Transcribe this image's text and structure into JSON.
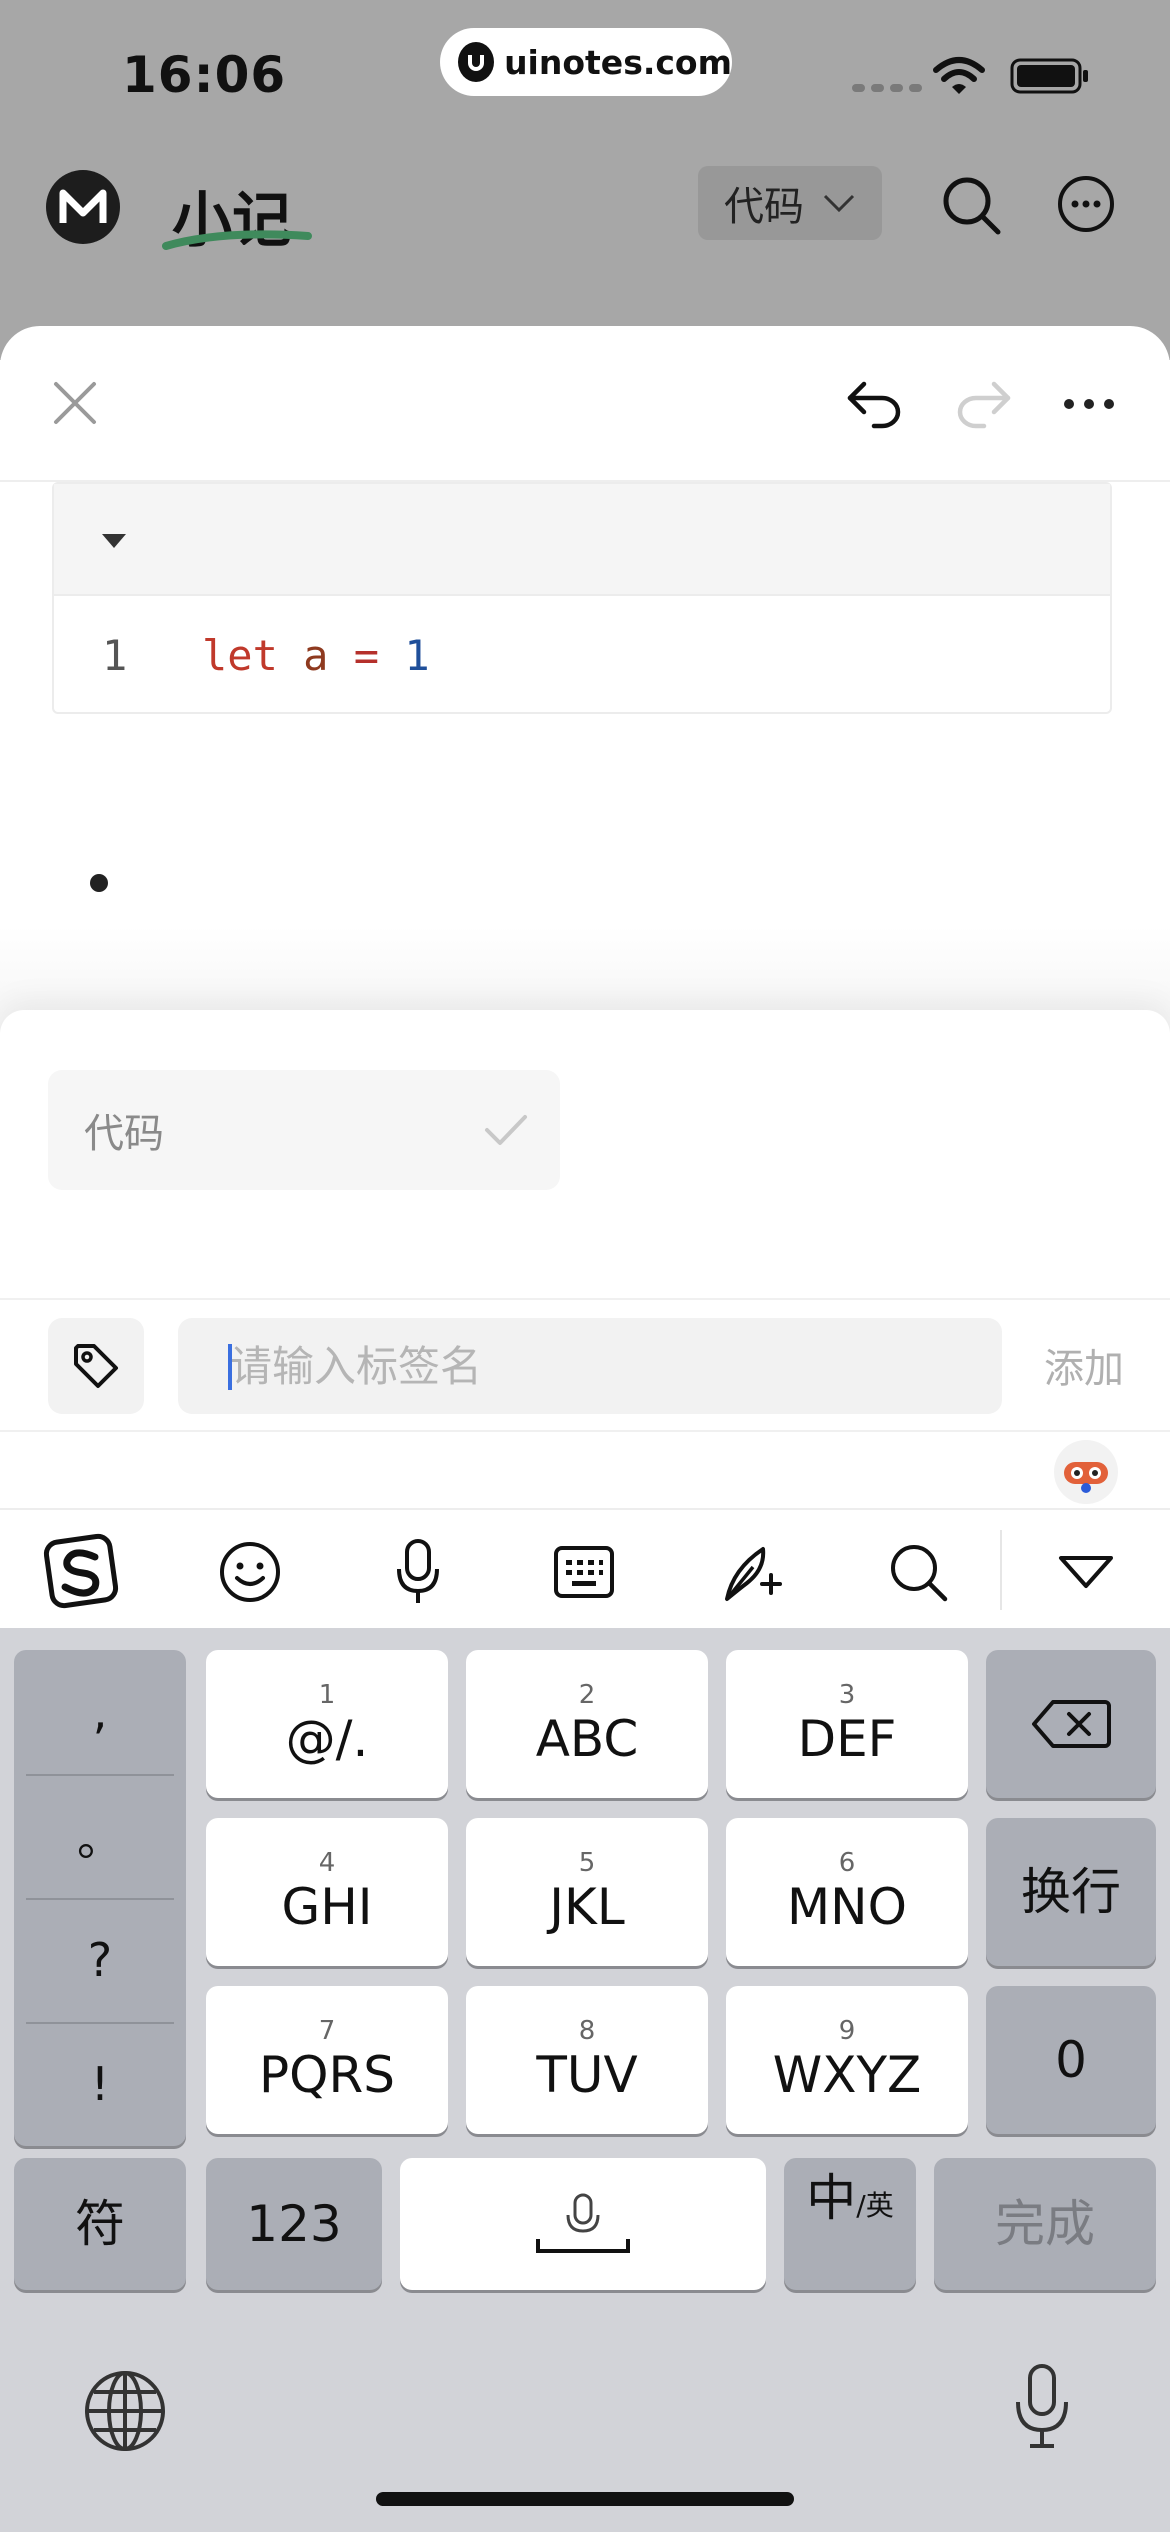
{
  "status_bar": {
    "time": "16:06",
    "url": "uinotes.com"
  },
  "app_header": {
    "title": "小记",
    "filter_label": "代码"
  },
  "editor": {
    "code_block": {
      "line_number": "1",
      "tokens": {
        "keyword": "let",
        "variable": "a",
        "operator": "=",
        "number": "1"
      }
    }
  },
  "tag_panel": {
    "selected_tag": "代码",
    "input_placeholder": "请输入标签名",
    "input_value": "",
    "add_label": "添加"
  },
  "keyboard": {
    "punctuation": [
      ",",
      "。",
      "?",
      "!"
    ],
    "keys": [
      {
        "num": "1",
        "label": "@/."
      },
      {
        "num": "2",
        "label": "ABC"
      },
      {
        "num": "3",
        "label": "DEF"
      },
      {
        "num": "4",
        "label": "GHI"
      },
      {
        "num": "5",
        "label": "JKL"
      },
      {
        "num": "6",
        "label": "MNO"
      },
      {
        "num": "7",
        "label": "PQRS"
      },
      {
        "num": "8",
        "label": "TUV"
      },
      {
        "num": "9",
        "label": "WXYZ"
      }
    ],
    "newline_label": "换行",
    "zero_label": "0",
    "symbol_label": "符",
    "numeric_label": "123",
    "lang_main": "中",
    "lang_sub": "/英",
    "done_label": "完成"
  },
  "colors": {
    "keyword": "#c0392b",
    "number": "#1f4f9a",
    "keyboard_bg": "#d2d3d8",
    "dim_overlay": "#a7a7a7"
  }
}
